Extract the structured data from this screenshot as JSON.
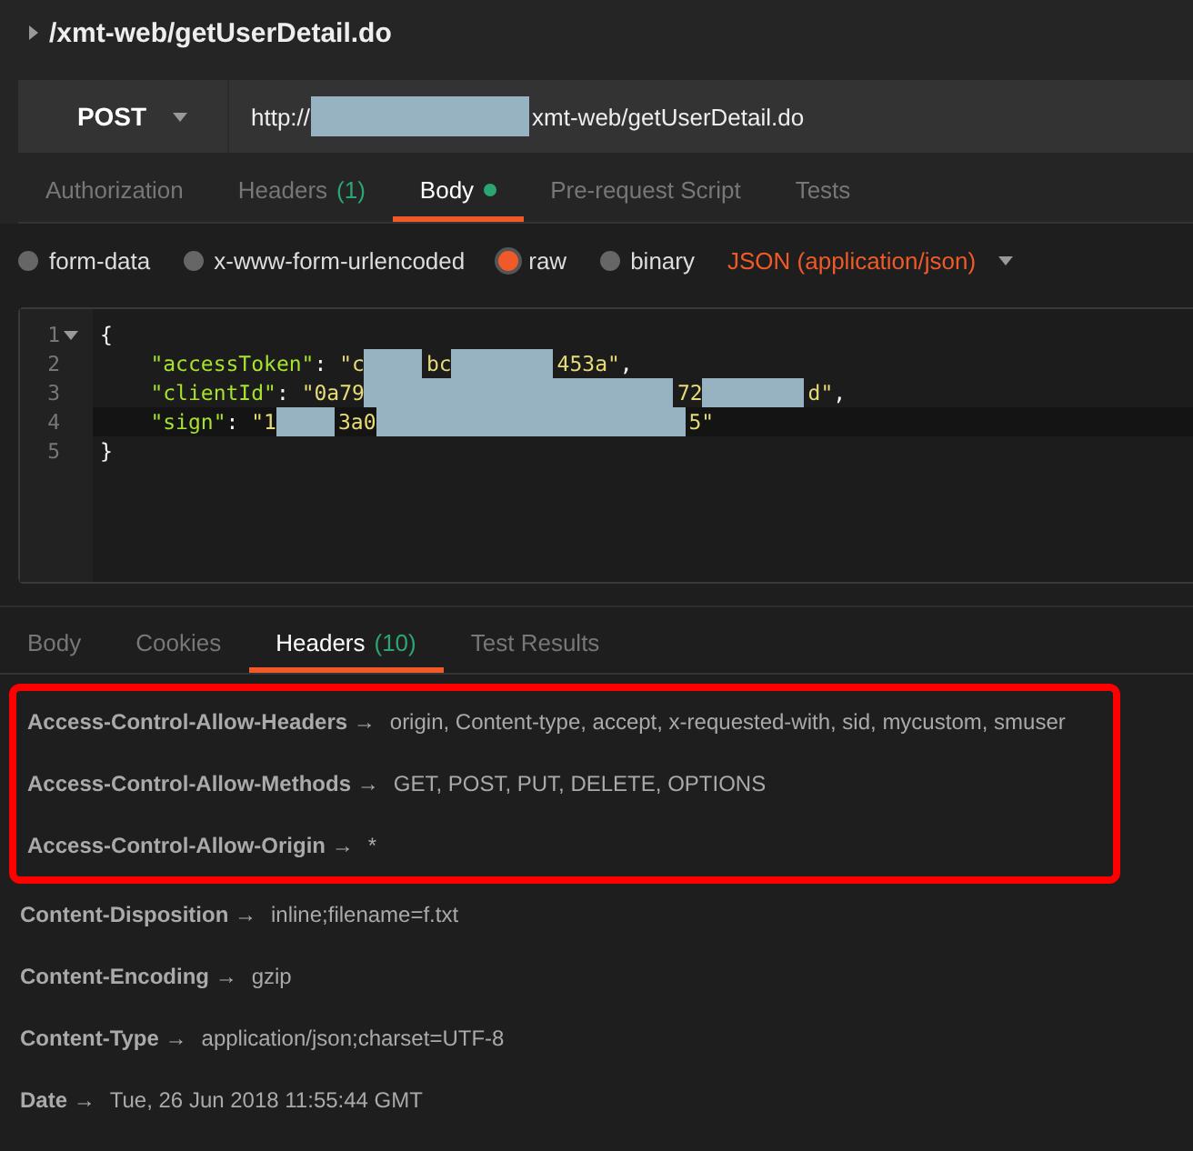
{
  "request": {
    "title": "/xmt-web/getUserDetail.do",
    "method": "POST",
    "url_parts": [
      {
        "kind": "text",
        "text": "http://"
      },
      {
        "kind": "redact"
      },
      {
        "kind": "text",
        "text": "xmt-web/getUserDetail.do"
      }
    ]
  },
  "request_tabs": [
    {
      "label": "Authorization",
      "selected": false,
      "dot": false
    },
    {
      "label": "Headers",
      "count": "(1)",
      "selected": false,
      "dot": false
    },
    {
      "label": "Body",
      "selected": true,
      "dot": true
    },
    {
      "label": "Pre-request Script",
      "selected": false,
      "dot": false
    },
    {
      "label": "Tests",
      "selected": false,
      "dot": false
    }
  ],
  "body_modes": [
    {
      "label": "form-data",
      "selected": false
    },
    {
      "label": "x-www-form-urlencoded",
      "selected": false
    },
    {
      "label": "raw",
      "selected": true
    },
    {
      "label": "binary",
      "selected": false
    }
  ],
  "content_type": "JSON (application/json)",
  "code_lines": [
    {
      "number": "1",
      "fold": true,
      "tokens": [
        {
          "kind": "punct",
          "text": "{"
        }
      ]
    },
    {
      "number": "2",
      "fold": false,
      "tokens": [
        {
          "kind": "indent"
        },
        {
          "kind": "key",
          "text": "\"accessToken\""
        },
        {
          "kind": "punct",
          "text": ": "
        },
        {
          "kind": "string",
          "text": "\"c"
        },
        {
          "kind": "redact"
        },
        {
          "kind": "string",
          "text": "bc"
        },
        {
          "kind": "redact"
        },
        {
          "kind": "string",
          "text": "453a\""
        },
        {
          "kind": "punct",
          "text": ","
        }
      ]
    },
    {
      "number": "3",
      "fold": false,
      "tokens": [
        {
          "kind": "indent"
        },
        {
          "kind": "key",
          "text": "\"clientId\""
        },
        {
          "kind": "punct",
          "text": ": "
        },
        {
          "kind": "string",
          "text": "\"0a79"
        },
        {
          "kind": "redact"
        },
        {
          "kind": "string",
          "text": "72"
        },
        {
          "kind": "redact"
        },
        {
          "kind": "string",
          "text": "d\""
        },
        {
          "kind": "punct",
          "text": ","
        }
      ]
    },
    {
      "number": "4",
      "fold": false,
      "tokens": [
        {
          "kind": "indent"
        },
        {
          "kind": "key",
          "text": "\"sign\""
        },
        {
          "kind": "punct",
          "text": ": "
        },
        {
          "kind": "string",
          "text": "\"1"
        },
        {
          "kind": "redact"
        },
        {
          "kind": "string",
          "text": "3a0"
        },
        {
          "kind": "redact"
        },
        {
          "kind": "string",
          "text": "5\""
        }
      ]
    },
    {
      "number": "5",
      "fold": false,
      "tokens": [
        {
          "kind": "punct",
          "text": "}"
        }
      ]
    }
  ],
  "response_tabs": [
    {
      "label": "Body",
      "selected": false
    },
    {
      "label": "Cookies",
      "selected": false
    },
    {
      "label": "Headers",
      "count": "(10)",
      "selected": true
    },
    {
      "label": "Test Results",
      "selected": false
    }
  ],
  "response_headers": [
    {
      "name": "Access-Control-Allow-Headers",
      "arrow": "→",
      "value": "origin, Content-type, accept, x-requested-with, sid, mycustom, smuser",
      "highlighted": true
    },
    {
      "name": "Access-Control-Allow-Methods",
      "arrow": "→",
      "value": "GET, POST, PUT, DELETE, OPTIONS",
      "highlighted": true
    },
    {
      "name": "Access-Control-Allow-Origin",
      "arrow": "→",
      "value": "*",
      "highlighted": true
    },
    {
      "name": "Content-Disposition",
      "arrow": "→",
      "value": "inline;filename=f.txt",
      "highlighted": false
    },
    {
      "name": "Content-Encoding",
      "arrow": "→",
      "value": "gzip",
      "highlighted": false
    },
    {
      "name": "Content-Type",
      "arrow": "→",
      "value": "application/json;charset=UTF-8",
      "highlighted": false
    },
    {
      "name": "Date",
      "arrow": "→",
      "value": "Tue, 26 Jun 2018 11:55:44 GMT",
      "highlighted": false
    }
  ]
}
